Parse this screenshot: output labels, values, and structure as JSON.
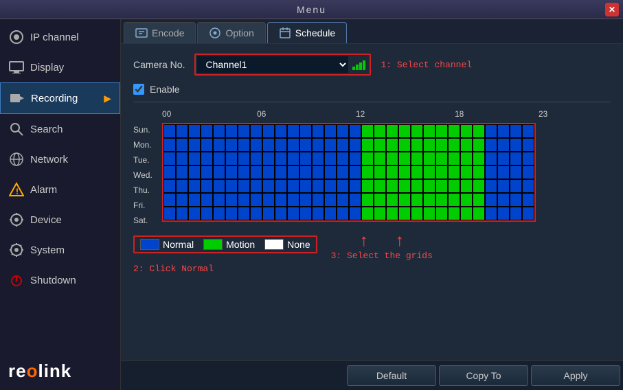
{
  "window": {
    "title": "Menu"
  },
  "sidebar": {
    "items": [
      {
        "id": "ip-channel",
        "label": "IP channel",
        "icon": "camera",
        "active": false
      },
      {
        "id": "display",
        "label": "Display",
        "icon": "display",
        "active": false
      },
      {
        "id": "recording",
        "label": "Recording",
        "icon": "recording",
        "active": true
      },
      {
        "id": "search",
        "label": "Search",
        "icon": "search",
        "active": false
      },
      {
        "id": "network",
        "label": "Network",
        "icon": "network",
        "active": false
      },
      {
        "id": "alarm",
        "label": "Alarm",
        "icon": "alarm",
        "active": false
      },
      {
        "id": "device",
        "label": "Device",
        "icon": "device",
        "active": false
      },
      {
        "id": "system",
        "label": "System",
        "icon": "system",
        "active": false
      },
      {
        "id": "shutdown",
        "label": "Shutdown",
        "icon": "shutdown",
        "active": false
      }
    ],
    "logo": "reolink"
  },
  "tabs": [
    {
      "id": "encode",
      "label": "Encode",
      "active": false
    },
    {
      "id": "option",
      "label": "Option",
      "active": false
    },
    {
      "id": "schedule",
      "label": "Schedule",
      "active": true
    }
  ],
  "content": {
    "camera_label": "Camera No.",
    "camera_value": "Channel1",
    "hint1": "1: Select channel",
    "enable_label": "Enable",
    "enable_checked": true,
    "hours": [
      "00",
      "06",
      "12",
      "18",
      "23"
    ],
    "days": [
      "Sun.",
      "Mon.",
      "Tue.",
      "Wed.",
      "Thu.",
      "Fri.",
      "Sat."
    ],
    "legend": [
      {
        "id": "normal",
        "label": "Normal",
        "color": "#0044cc"
      },
      {
        "id": "motion",
        "label": "Motion",
        "color": "#00cc00"
      },
      {
        "id": "none",
        "label": "None",
        "color": "#ffffff"
      }
    ],
    "hint2": "2: Click Normal",
    "hint3": "3: Select the grids",
    "buttons": [
      {
        "id": "default",
        "label": "Default"
      },
      {
        "id": "copy-to",
        "label": "Copy To"
      },
      {
        "id": "apply",
        "label": "Apply"
      }
    ]
  }
}
